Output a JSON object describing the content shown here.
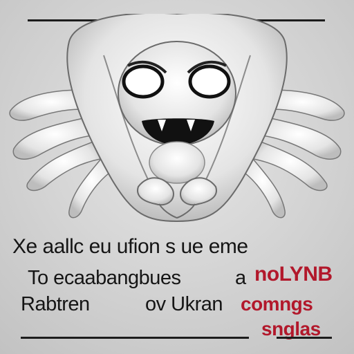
{
  "caption": {
    "line1": "Xe aallc eu ufion s ue eme",
    "line2_a": "To ecaabangbues",
    "line2_b": "a",
    "line2_c": "noLYNB",
    "line3_a": "Rabtren",
    "line3_b": "ov Ukran",
    "line3_c": "comngs",
    "line4": "snglas"
  },
  "colors": {
    "background": "#c9c9c9",
    "ink": "#151515",
    "accent_red": "#b2182b"
  }
}
